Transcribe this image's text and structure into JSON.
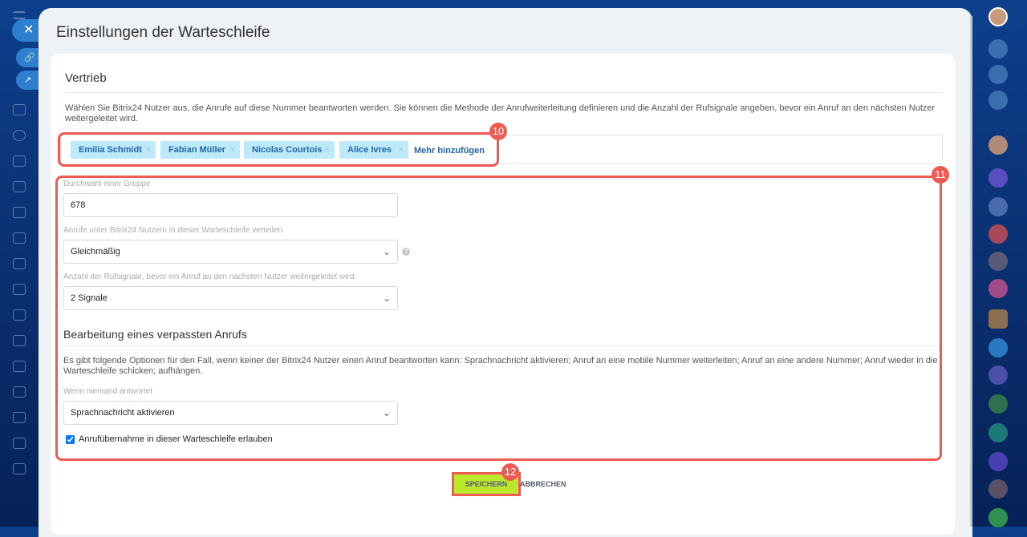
{
  "panel": {
    "title": "Einstellungen der Warteschleife"
  },
  "group": {
    "name": "Vertrieb",
    "description": "Wählen Sie Bitrix24 Nutzer aus, die Anrufe auf diese Nummer beantworten werden. Sie können die Methode der Anrufweiterleitung definieren und die Anzahl der Rufsignale angeben, bevor ein Anruf an den nächsten Nutzer weitergeleitet wird.",
    "users": [
      "Emilia Schmidt",
      "Fabian Müller",
      "Nicolas Courtois",
      "Alice Ivres"
    ],
    "add_more": "Mehr hinzufügen"
  },
  "fields": {
    "extension_label": "Durchwahl einer Gruppe",
    "extension_value": "678",
    "distribution_label": "Anrufe unter Bitrix24 Nutzern in dieser Warteschleife verteilen",
    "distribution_value": "Gleichmäßig",
    "rings_label": "Anzahl der Rufsignale, bevor ein Anruf an den nächsten Nutzer weitergeleitet wird",
    "rings_value": "2 Signale"
  },
  "missed": {
    "title": "Bearbeitung eines verpassten Anrufs",
    "description": "Es gibt folgende Optionen für den Fall, wenn keiner der Bitrix24 Nutzer einen Anruf beantworten kann: Sprachnachricht aktivieren; Anruf an eine mobile Nummer weiterleiten; Anruf an eine andere Nummer; Anruf wieder in die Warteschleife schicken; aufhängen.",
    "no_answer_label": "Wenn niemand antwortet",
    "no_answer_value": "Sprachnachricht aktivieren",
    "pickup_label": "Anrufübernahme in dieser Warteschleife erlauben",
    "pickup_checked": true
  },
  "buttons": {
    "save": "SPEICHERN",
    "cancel": "ABBRECHEN"
  },
  "annotations": [
    "10",
    "11",
    "12"
  ],
  "colors": {
    "highlight": "#ef5b52",
    "save": "#bbe82b",
    "tag": "#bde9f8"
  }
}
